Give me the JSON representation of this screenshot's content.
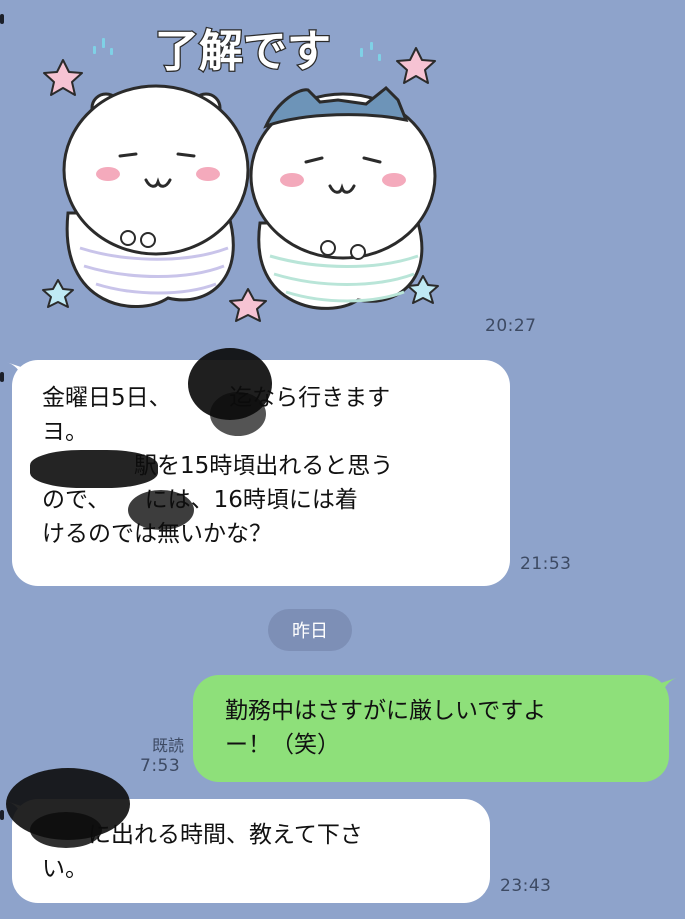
{
  "sticker": {
    "caption": "了解です",
    "time": "20:27"
  },
  "messages": [
    {
      "id": "m1",
      "side": "in",
      "text": "金曜日5日、　　　迄なら行きます\nヨ。\n　　　　駅を15時頃出れると思う\nので、　　には、16時頃には着\nけるのでは無いかな？",
      "time": "21:53"
    },
    {
      "id": "m2",
      "side": "out",
      "text": "勤務中はさすがに厳しいですよ\nー！（笑）",
      "read": "既読",
      "time": "7:53"
    },
    {
      "id": "m3",
      "side": "in",
      "text": "　　に出れる時間、教えて下さ\nい。",
      "time": "23:43"
    }
  ],
  "date_separator": "昨日",
  "colors": {
    "background": "#8ea3cb",
    "incoming": "#ffffff",
    "outgoing": "#8ee07a",
    "pill": "#7d8fb6"
  }
}
